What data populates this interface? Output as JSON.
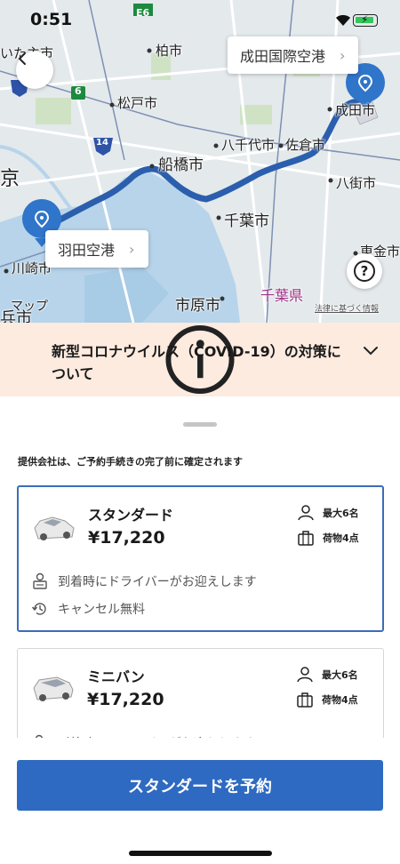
{
  "status": {
    "time": "0:51"
  },
  "map": {
    "labels": {
      "ichikawa_partial": "いた主市",
      "kashiwa": "柏市",
      "matsudo": "松戸市",
      "yachiyo": "八千代市",
      "sakura": "佐倉市",
      "narita": "成田市",
      "funabashi": "船橋市",
      "tokyo_partial": "京",
      "yachimata": "八街市",
      "chiba": "千葉市",
      "togane": "東金市",
      "kawasaki": "川崎市",
      "ichihara": "市原市",
      "chiba_pref": "千葉県",
      "map_brand": "マップ",
      "legal": "法律に基づく情報",
      "shi_partial": "兵市",
      "road_e6": "E6",
      "road_6": "6",
      "road_14": "14"
    },
    "destination_callout": "成田国際空港",
    "origin_callout": "羽田空港",
    "route_color": "#2b5fad",
    "pin_color": "#2f75c9"
  },
  "notice": {
    "text": "新型コロナウイルス（COVID-19）の対策について"
  },
  "sheet": {
    "provider_note": "提供会社は、ご予約手続きの完了前に確定されます",
    "options": [
      {
        "name": "スタンダード",
        "price": "¥17,220",
        "passengers": "最大6名",
        "luggage": "荷物4点",
        "features": [
          "到着時にドライバーがお迎えします",
          "キャンセル無料"
        ],
        "selected": true
      },
      {
        "name": "ミニバン",
        "price": "¥17,220",
        "passengers": "最大6名",
        "luggage": "荷物4点",
        "features": [
          "到着時にドライバーがお迎えします"
        ],
        "selected": false
      }
    ]
  },
  "cta": {
    "label": "スタンダードを予約"
  },
  "colors": {
    "accent": "#2e6ac1",
    "notice_bg": "#fdebe0"
  }
}
